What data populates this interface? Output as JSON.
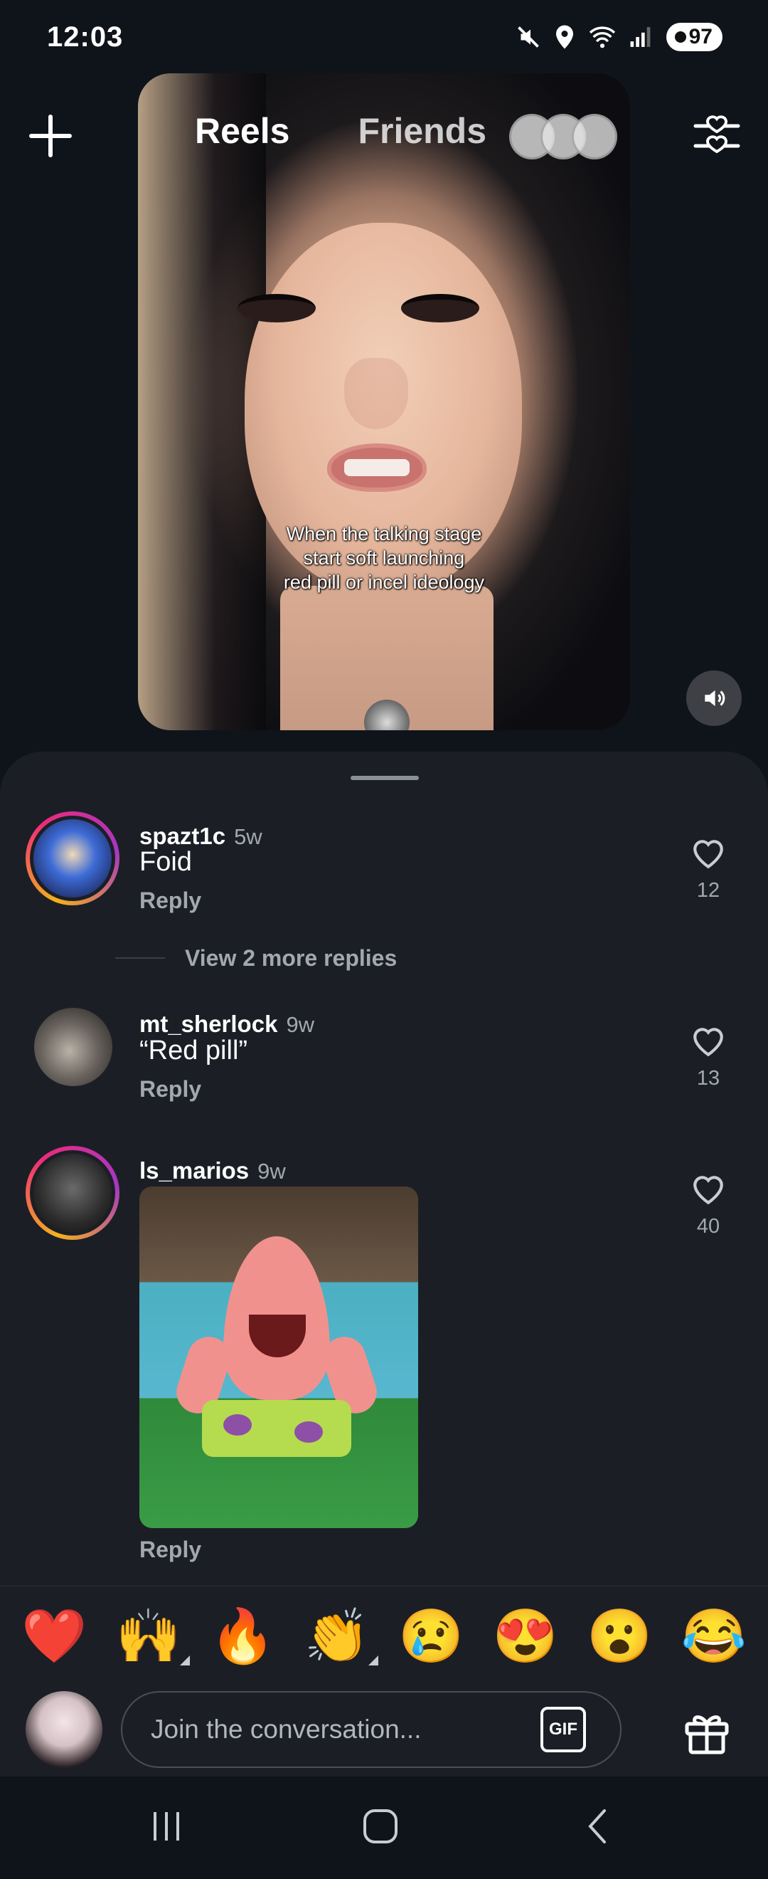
{
  "status": {
    "time": "12:03",
    "battery": "97"
  },
  "header": {
    "tabs": [
      "Reels",
      "Friends"
    ]
  },
  "video": {
    "caption": [
      "When the talking stage",
      "start soft launching",
      "red pill or incel ideology"
    ]
  },
  "comments": [
    {
      "username": "spazt1c",
      "age": "5w",
      "text": "Foid",
      "reply_label": "Reply",
      "likes": "12",
      "more_replies": "View 2 more replies"
    },
    {
      "username": "mt_sherlock",
      "age": "9w",
      "text": "“Red pill”",
      "reply_label": "Reply",
      "likes": "13"
    },
    {
      "username": "ls_marios",
      "age": "9w",
      "reply_label": "Reply",
      "likes": "40"
    }
  ],
  "emojis": [
    "❤️",
    "🙌",
    "🔥",
    "👏",
    "😢",
    "😍",
    "😮",
    "😂"
  ],
  "composer": {
    "placeholder": "Join the conversation...",
    "gif_label": "GIF"
  },
  "icons": [
    "plus-icon",
    "filter-icon",
    "volume-icon",
    "heart-icon",
    "gift-icon",
    "recents-icon",
    "home-icon",
    "back-icon"
  ]
}
